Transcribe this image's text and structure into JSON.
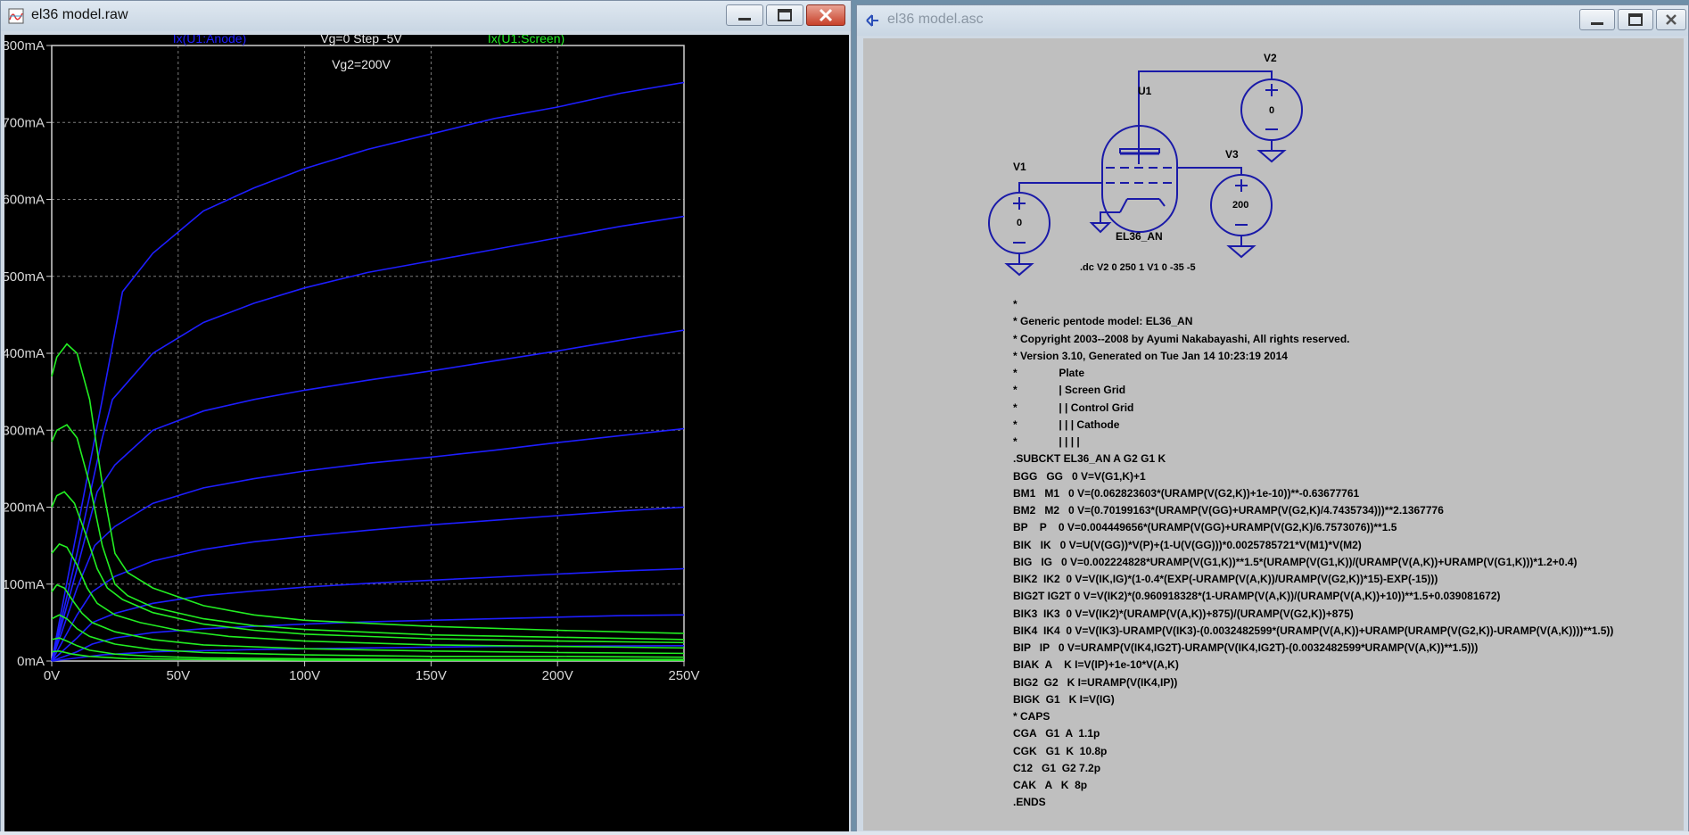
{
  "raw_window": {
    "title": "el36 model.raw",
    "icon": "waveform-icon",
    "controls": [
      "minimize-icon",
      "maximize-icon",
      "close-icon"
    ]
  },
  "plot": {
    "traces": [
      {
        "name": "Ix(U1:Anode)",
        "color": "#1e1eff"
      },
      {
        "name": "Ix(U1:Screen)",
        "color": "#22ee22"
      }
    ],
    "step_label": "Vg=0  Step -5V",
    "vg2_label": "Vg2=200V",
    "background": "#000000",
    "grid_color": "#7a7a7a"
  },
  "chart_data": {
    "type": "line",
    "xlabel": "",
    "ylabel": "",
    "x_ticks": [
      "0V",
      "50V",
      "100V",
      "150V",
      "200V",
      "250V"
    ],
    "y_ticks": [
      "0mA",
      "100mA",
      "200mA",
      "300mA",
      "400mA",
      "500mA",
      "600mA",
      "700mA",
      "800mA"
    ],
    "xlim": [
      0,
      250
    ],
    "ylim": [
      0,
      800
    ],
    "grid": true,
    "x_unit": "V",
    "y_unit": "mA",
    "series": [
      {
        "name": "Ix(U1:Anode)",
        "color": "#1e1eff",
        "curves": [
          {
            "vg": 0,
            "x": [
              0,
              10,
              20,
              28,
              40,
              60,
              80,
              100,
              125,
              150,
              175,
              200,
              225,
              250
            ],
            "y": [
              0,
              170,
              340,
              480,
              530,
              585,
              615,
              640,
              665,
              685,
              705,
              720,
              738,
              752
            ]
          },
          {
            "vg": -5,
            "x": [
              0,
              10,
              20,
              24,
              40,
              60,
              80,
              100,
              125,
              150,
              175,
              200,
              225,
              250
            ],
            "y": [
              0,
              140,
              290,
              340,
              400,
              440,
              465,
              485,
              505,
              520,
              535,
              550,
              565,
              578
            ]
          },
          {
            "vg": -10,
            "x": [
              0,
              10,
              18,
              25,
              40,
              60,
              80,
              100,
              125,
              150,
              175,
              200,
              225,
              250
            ],
            "y": [
              0,
              120,
              220,
              255,
              300,
              325,
              340,
              352,
              365,
              377,
              390,
              403,
              417,
              430
            ]
          },
          {
            "vg": -15,
            "x": [
              0,
              10,
              17,
              25,
              40,
              60,
              80,
              100,
              125,
              150,
              175,
              200,
              225,
              250
            ],
            "y": [
              0,
              95,
              150,
              175,
              205,
              225,
              237,
              247,
              257,
              265,
              274,
              284,
              293,
              302
            ]
          },
          {
            "vg": -20,
            "x": [
              0,
              10,
              16,
              25,
              40,
              60,
              80,
              100,
              125,
              150,
              175,
              200,
              225,
              250
            ],
            "y": [
              0,
              60,
              90,
              110,
              130,
              145,
              155,
              162,
              170,
              177,
              183,
              189,
              195,
              200
            ]
          },
          {
            "vg": -25,
            "x": [
              0,
              10,
              16,
              25,
              40,
              60,
              80,
              100,
              125,
              150,
              175,
              200,
              225,
              250
            ],
            "y": [
              0,
              30,
              50,
              62,
              75,
              85,
              91,
              96,
              101,
              105,
              109,
              113,
              117,
              120
            ]
          },
          {
            "vg": -30,
            "x": [
              0,
              10,
              16,
              25,
              40,
              60,
              80,
              100,
              125,
              150,
              175,
              200,
              225,
              250
            ],
            "y": [
              0,
              12,
              22,
              30,
              37,
              42,
              45,
              48,
              51,
              53,
              55,
              57,
              59,
              60
            ]
          },
          {
            "vg": -35,
            "x": [
              0,
              10,
              20,
              40,
              80,
              125,
              175,
              250
            ],
            "y": [
              0,
              4,
              8,
              12,
              15,
              17,
              19,
              20
            ]
          }
        ]
      },
      {
        "name": "Ix(U1:Screen)",
        "color": "#22ee22",
        "curves": [
          {
            "vg": 0,
            "x": [
              0,
              2,
              6,
              10,
              15,
              20,
              25,
              30,
              40,
              60,
              80,
              100,
              150,
              200,
              250
            ],
            "y": [
              370,
              395,
              412,
              400,
              340,
              230,
              140,
              115,
              95,
              72,
              60,
              53,
              45,
              40,
              36
            ]
          },
          {
            "vg": -5,
            "x": [
              0,
              2,
              6,
              10,
              15,
              20,
              25,
              30,
              40,
              60,
              80,
              100,
              150,
              200,
              250
            ],
            "y": [
              285,
              300,
              307,
              290,
              230,
              150,
              100,
              85,
              70,
              55,
              46,
              41,
              34,
              31,
              28
            ]
          },
          {
            "vg": -10,
            "x": [
              0,
              2,
              5,
              9,
              14,
              18,
              22,
              28,
              40,
              60,
              80,
              100,
              150,
              200,
              250
            ],
            "y": [
              200,
              215,
              220,
              205,
              160,
              120,
              95,
              80,
              63,
              48,
              40,
              35,
              29,
              26,
              24
            ]
          },
          {
            "vg": -15,
            "x": [
              0,
              3,
              6,
              10,
              14,
              18,
              25,
              35,
              50,
              70,
              100,
              150,
              200,
              250
            ],
            "y": [
              140,
              152,
              148,
              125,
              95,
              75,
              60,
              50,
              40,
              32,
              26,
              21,
              19,
              17
            ]
          },
          {
            "vg": -20,
            "x": [
              0,
              2,
              5,
              8,
              12,
              16,
              25,
              40,
              60,
              100,
              150,
              200,
              250
            ],
            "y": [
              90,
              99,
              95,
              80,
              62,
              50,
              38,
              28,
              21,
              16,
              13,
              11,
              10
            ]
          },
          {
            "vg": -25,
            "x": [
              0,
              3,
              6,
              10,
              15,
              25,
              40,
              60,
              100,
              150,
              200,
              250
            ],
            "y": [
              55,
              60,
              55,
              42,
              32,
              22,
              15,
              11,
              8,
              6,
              6,
              5
            ]
          },
          {
            "vg": -30,
            "x": [
              0,
              3,
              6,
              10,
              15,
              25,
              40,
              60,
              100,
              150,
              250
            ],
            "y": [
              28,
              30,
              26,
              20,
              14,
              9,
              6,
              4,
              3,
              2,
              2
            ]
          },
          {
            "vg": -35,
            "x": [
              0,
              3,
              8,
              15,
              30,
              60,
              100,
              250
            ],
            "y": [
              12,
              13,
              9,
              6,
              3,
              2,
              1,
              1
            ]
          }
        ]
      }
    ]
  },
  "asc_window": {
    "title": "el36 model.asc",
    "icon": "schematic-icon",
    "controls": [
      "minimize-icon",
      "maximize-icon",
      "close-icon"
    ]
  },
  "schematic": {
    "tube_label": "U1",
    "tube_model": "EL36_AN",
    "v1_label": "V1",
    "v1_value": "0",
    "v2_label": "V2",
    "v2_value": "0",
    "v3_label": "V3",
    "v3_value": "200",
    "directive": ".dc V2 0 250 1 V1 0 -35 -5",
    "netlist": [
      "*",
      "* Generic pentode model: EL36_AN",
      "* Copyright 2003--2008 by Ayumi Nakabayashi, All rights reserved.",
      "* Version 3.10, Generated on Tue Jan 14 10:23:19 2014",
      "*              Plate",
      "*              | Screen Grid",
      "*              | | Control Grid",
      "*              | | | Cathode",
      "*              | | | |",
      ".SUBCKT EL36_AN A G2 G1 K",
      "BGG   GG   0 V=V(G1,K)+1",
      "BM1   M1   0 V=(0.062823603*(URAMP(V(G2,K))+1e-10))**-0.63677761",
      "BM2   M2   0 V=(0.70199163*(URAMP(V(GG)+URAMP(V(G2,K)/4.7435734)))**2.1367776",
      "BP    P    0 V=0.004449656*(URAMP(V(GG)+URAMP(V(G2,K)/6.7573076))**1.5",
      "BIK   IK   0 V=U(V(GG))*V(P)+(1-U(V(GG)))*0.0025785721*V(M1)*V(M2)",
      "BIG   IG   0 V=0.002224828*URAMP(V(G1,K))**1.5*(URAMP(V(G1,K))/(URAMP(V(A,K))+URAMP(V(G1,K)))*1.2+0.4)",
      "BIK2  IK2  0 V=V(IK,IG)*(1-0.4*(EXP(-URAMP(V(A,K))/URAMP(V(G2,K))*15)-EXP(-15)))",
      "BIG2T IG2T 0 V=V(IK2)*(0.960918328*(1-URAMP(V(A,K))/(URAMP(V(A,K))+10))**1.5+0.039081672)",
      "BIK3  IK3  0 V=V(IK2)*(URAMP(V(A,K))+875)/(URAMP(V(G2,K))+875)",
      "BIK4  IK4  0 V=V(IK3)-URAMP(V(IK3)-(0.0032482599*(URAMP(V(A,K))+URAMP(URAMP(V(G2,K))-URAMP(V(A,K))))**1.5))",
      "BIP   IP   0 V=URAMP(V(IK4,IG2T)-URAMP(V(IK4,IG2T)-(0.0032482599*URAMP(V(A,K))**1.5)))",
      "BIAK  A    K I=V(IP)+1e-10*V(A,K)",
      "BIG2  G2   K I=URAMP(V(IK4,IP))",
      "BIGK  G1   K I=V(IG)",
      "* CAPS",
      "CGA   G1  A  1.1p",
      "CGK   G1  K  10.8p",
      "C12   G1  G2 7.2p",
      "CAK   A   K  8p",
      ".ENDS"
    ]
  }
}
